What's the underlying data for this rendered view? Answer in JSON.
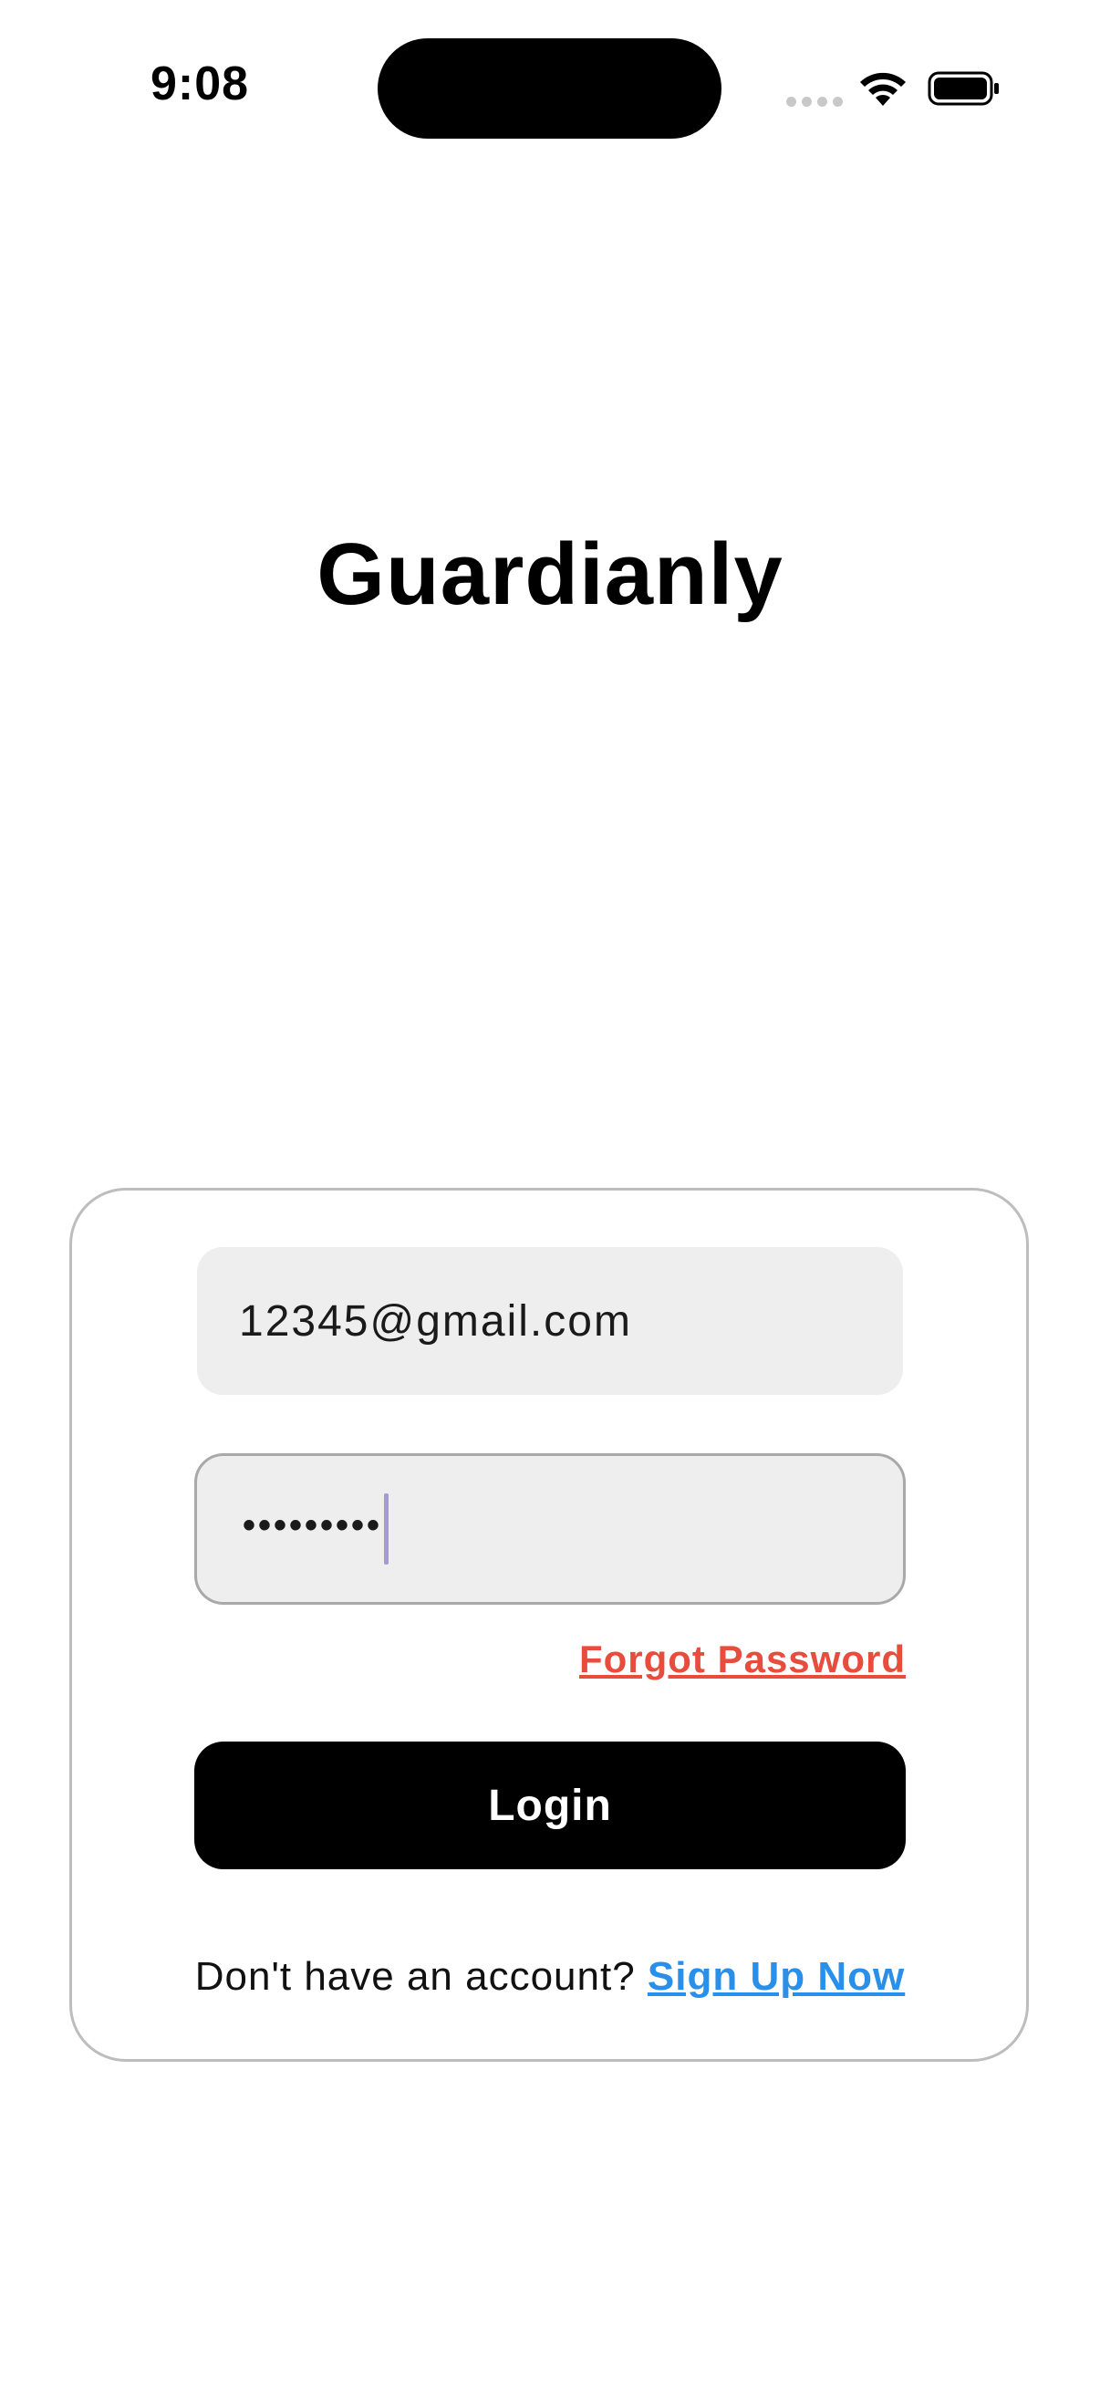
{
  "status_bar": {
    "time": "9:08"
  },
  "app": {
    "title": "Guardianly"
  },
  "login_form": {
    "email_value": "12345@gmail.com",
    "password_value": "•••••••••",
    "forgot_password_label": "Forgot Password",
    "login_button_label": "Login",
    "signup_prompt": "Don't have an account?",
    "signup_link_label": "Sign Up Now"
  },
  "colors": {
    "forgot_link": "#e74c3c",
    "signup_link": "#2a8fe8",
    "button_bg": "#000000",
    "field_bg": "#eeeeee"
  },
  "icons": [
    "cellular-signal-icon",
    "wifi-icon",
    "battery-icon"
  ]
}
